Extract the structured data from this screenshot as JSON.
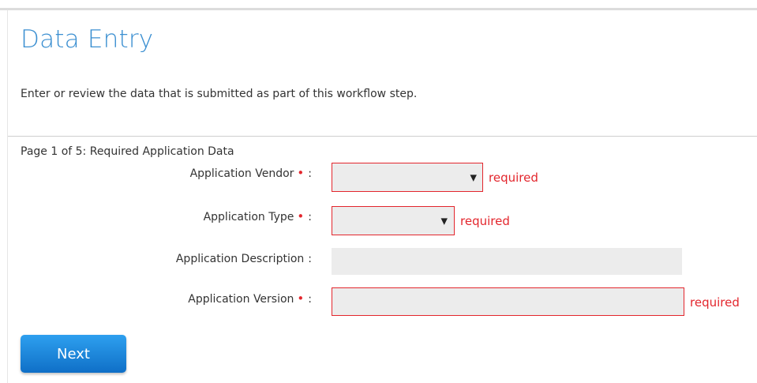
{
  "header": {
    "title": "Data Entry",
    "intro": "Enter or review the data that is submitted as part of this workflow step."
  },
  "form": {
    "page_info": "Page 1 of 5: Required Application Data",
    "required_marker": "•",
    "colon": ":",
    "fields": [
      {
        "label": "Application Vendor",
        "required": true,
        "value": "",
        "validation": "required"
      },
      {
        "label": "Application Type",
        "required": true,
        "value": "",
        "validation": "required"
      },
      {
        "label": "Application Description",
        "required": false,
        "value": ""
      },
      {
        "label": "Application Version",
        "required": true,
        "value": "",
        "validation": "required"
      }
    ],
    "next_label": "Next"
  },
  "colors": {
    "title": "#3b8fd1",
    "error": "#e3262d",
    "button": "#1a85dd",
    "field_bg": "#ececec"
  },
  "icons": {
    "dropdown": "caret-down-icon"
  }
}
